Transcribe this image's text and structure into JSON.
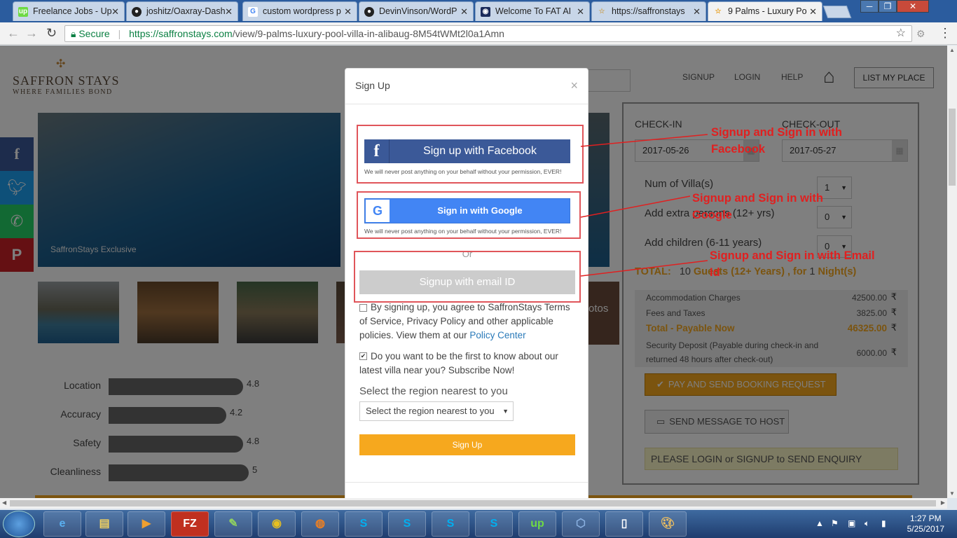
{
  "browser": {
    "tabs": [
      {
        "title": "Freelance Jobs - Up"
      },
      {
        "title": "joshitz/Oaxray-Dash"
      },
      {
        "title": "custom wordpress p"
      },
      {
        "title": "DevinVinson/WordP"
      },
      {
        "title": "Welcome To FAT AI"
      },
      {
        "title": "https://saffronstays"
      },
      {
        "title": "9 Palms - Luxury Po"
      }
    ],
    "secure_label": "Secure",
    "url_host": "https://saffronstays.com",
    "url_path": "/view/9-palms-luxury-pool-villa-in-alibaug-8M54tWMt2l0a1Amn"
  },
  "site": {
    "logo_name": "SAFFRON STAYS",
    "logo_tagline": "WHERE FAMILIES BOND",
    "nav": {
      "signup": "SIGNUP",
      "login": "LOGIN",
      "help": "HELP",
      "list_place": "LIST MY PLACE"
    },
    "hero_caption": "SaffronStays Exclusive",
    "more_photos": "otos"
  },
  "ratings": [
    {
      "label": "Location",
      "value": "4.8",
      "score": 4.8
    },
    {
      "label": "Accuracy",
      "value": "4.2",
      "score": 4.2
    },
    {
      "label": "Safety",
      "value": "4.8",
      "score": 4.8
    },
    {
      "label": "Cleanliness",
      "value": "5",
      "score": 5
    }
  ],
  "booking": {
    "checkin_label": "CHECK-IN",
    "checkout_label": "CHECK-OUT",
    "checkin_value": "2017-05-26",
    "checkout_value": "2017-05-27",
    "villas_label": "Num of Villa(s)",
    "villas_value": "1",
    "extra_label": "Add extra persons (12+ yrs)",
    "extra_value": "0",
    "children_label": "Add children (6-11 years)",
    "children_value": "0",
    "total_label": "TOTAL:",
    "total_guests": "10",
    "total_guests_text": "Guests (12+ Years) , for",
    "total_nights": "1",
    "total_nights_text": "Night(s)",
    "charges": [
      {
        "label": "Accommodation Charges",
        "amount": "42500.00"
      },
      {
        "label": "Fees and Taxes",
        "amount": "3825.00"
      },
      {
        "label": "Total - Payable Now",
        "amount": "46325.00"
      }
    ],
    "deposit_label_1": "Security Deposit (Payable during check-in and",
    "deposit_label_2": "returned 48 hours after check-out)",
    "deposit_amount": "6000.00",
    "rupee_symbol": "₹",
    "pay_button": "PAY AND SEND BOOKING REQUEST",
    "message_button": "SEND MESSAGE TO HOST",
    "login_note": "PLEASE LOGIN or SIGNUP to SEND ENQUIRY"
  },
  "modal": {
    "title": "Sign Up",
    "close": "×",
    "facebook_button": "Sign up with Facebook",
    "google_button": "Sign in with Google",
    "privacy_note": "We will never post anything on your behalf without your permission, EVER!",
    "or": "Or",
    "email_button": "Signup with email ID",
    "terms_text": "By signing up, you agree to SaffronStays Terms of Service, Privacy Policy and other applicable policies. View them at our",
    "policy_link": "Policy Center",
    "subscribe_text": "Do you want to be the first to know about our latest villa near you? Subscribe Now!",
    "region_label": "Select the region nearest to you",
    "region_placeholder": "Select the region nearest to you",
    "signup_button": "Sign Up"
  },
  "annotations": {
    "facebook_1": "Signup and Sign in with",
    "facebook_2": "Facebook",
    "google_1": "Signup and Sign in with",
    "google_2": "Google",
    "email_1": "Signup and Sign in with Email",
    "email_2": "Id"
  },
  "taskbar": {
    "time": "1:27 PM",
    "date": "5/25/2017"
  },
  "colors": {
    "accent": "#f6a81e",
    "facebook": "#3b5998",
    "google": "#4285f4",
    "annotation": "#e02020"
  }
}
